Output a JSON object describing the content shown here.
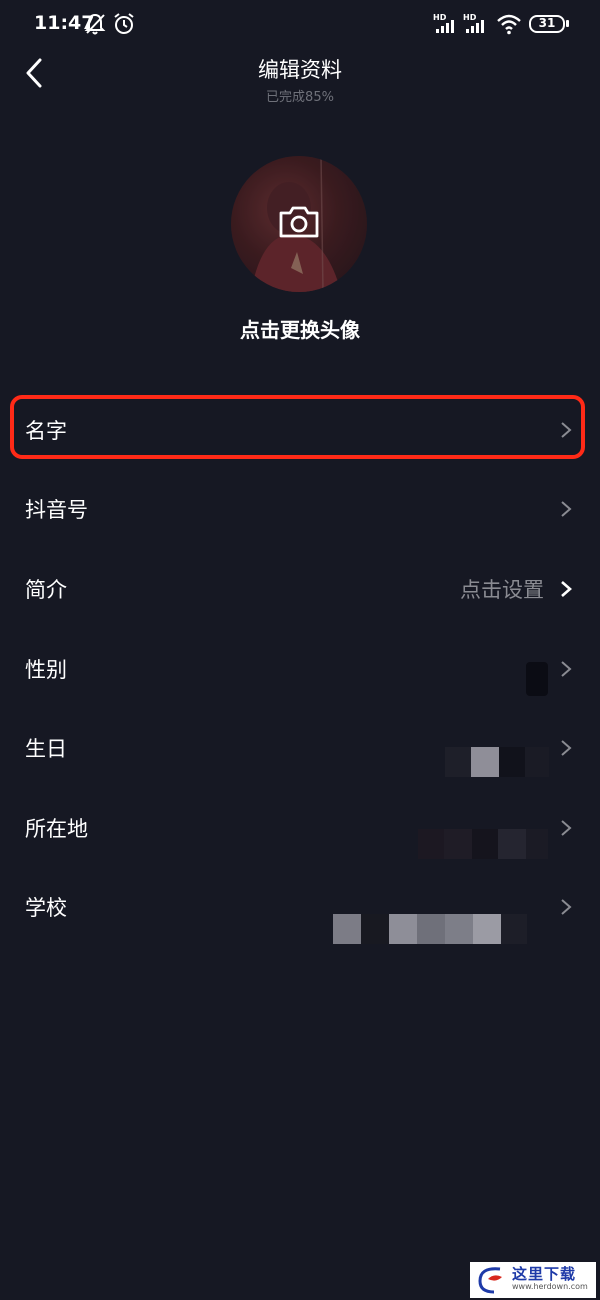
{
  "status_bar": {
    "time": "11:47",
    "battery": "31",
    "icons": [
      "silent-bell-icon",
      "alarm-icon",
      "hd-signal-icon",
      "hd-signal-icon",
      "wifi-icon",
      "battery-icon"
    ]
  },
  "header": {
    "back_icon": "chevron-left-icon",
    "title": "编辑资料",
    "subtitle": "已完成85%"
  },
  "avatar": {
    "icon": "camera-icon",
    "hint": "点击更换头像"
  },
  "rows": [
    {
      "label": "名字",
      "value": "",
      "highlighted": true
    },
    {
      "label": "抖音号",
      "value": ""
    },
    {
      "label": "简介",
      "value": "点击设置"
    },
    {
      "label": "性别",
      "value": ""
    },
    {
      "label": "生日",
      "value": ""
    },
    {
      "label": "所在地",
      "value": ""
    },
    {
      "label": "学校",
      "value": ""
    }
  ],
  "colors": {
    "background": "#161823",
    "highlight_border": "#ff2a17",
    "muted_text": "#8a8b92"
  },
  "watermark": {
    "text": "这里下载",
    "sub": "www.herdown.com"
  }
}
